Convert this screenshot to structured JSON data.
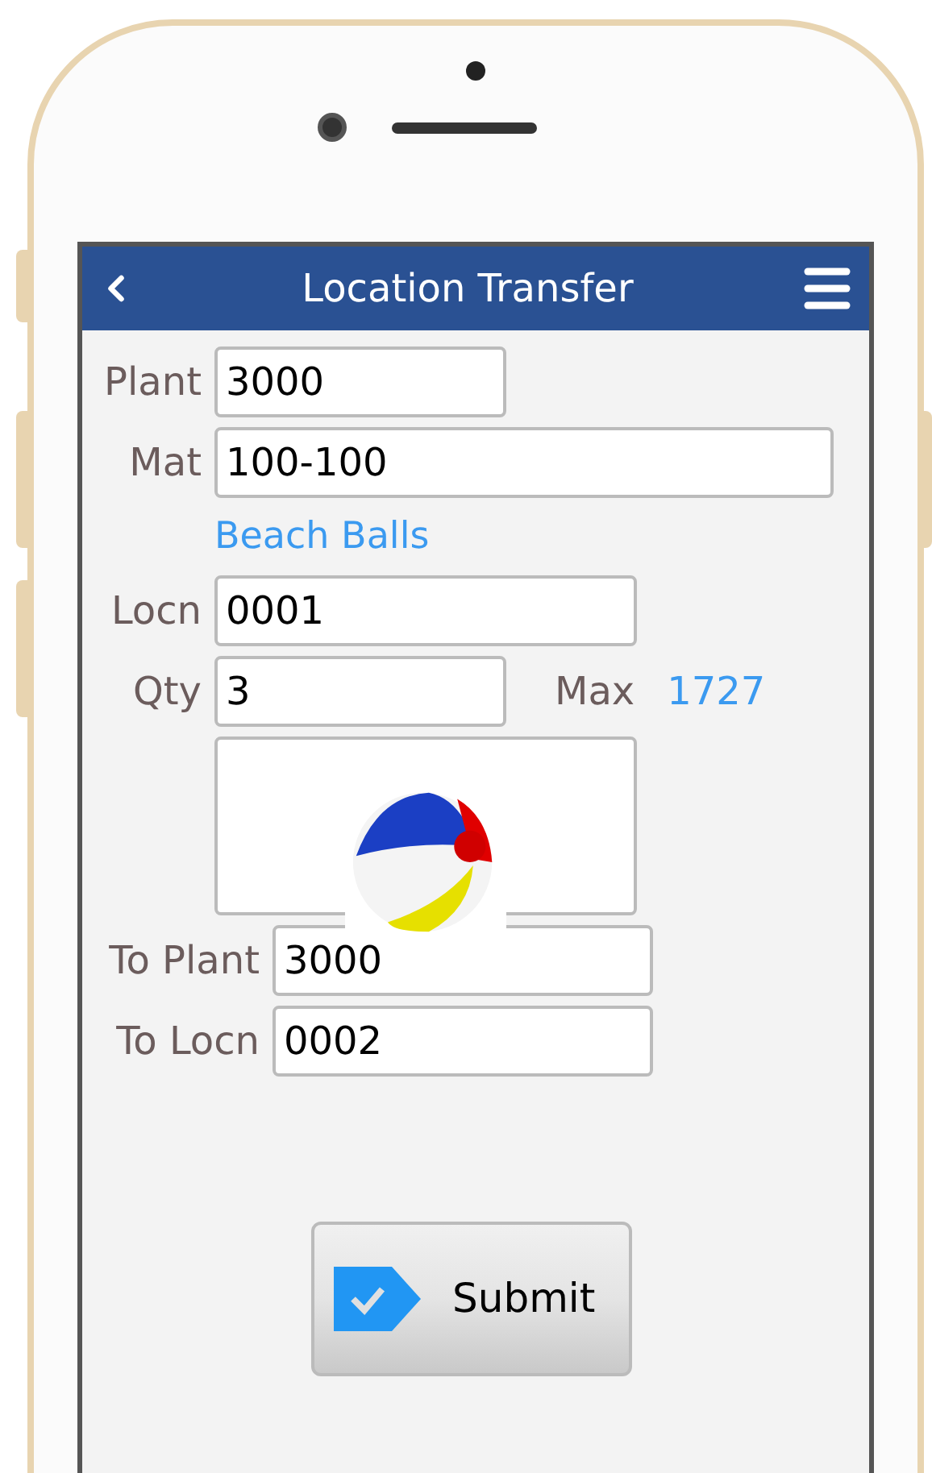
{
  "header": {
    "title": "Location Transfer"
  },
  "fields": [
    {
      "label": "Plant",
      "value": "3000"
    },
    {
      "label": "Mat",
      "value": "100-100"
    },
    {
      "kind": "description",
      "value": "Beach Balls"
    },
    {
      "label": "Locn",
      "value": "0001"
    },
    {
      "label": "Qty",
      "value": "3",
      "extra_label": "Max",
      "extra_value": "1727"
    }
  ],
  "to_fields": [
    {
      "label": "To Plant",
      "value": "3000"
    },
    {
      "label": "To Locn",
      "value": "0002"
    }
  ],
  "submit": {
    "label": "Submit"
  }
}
